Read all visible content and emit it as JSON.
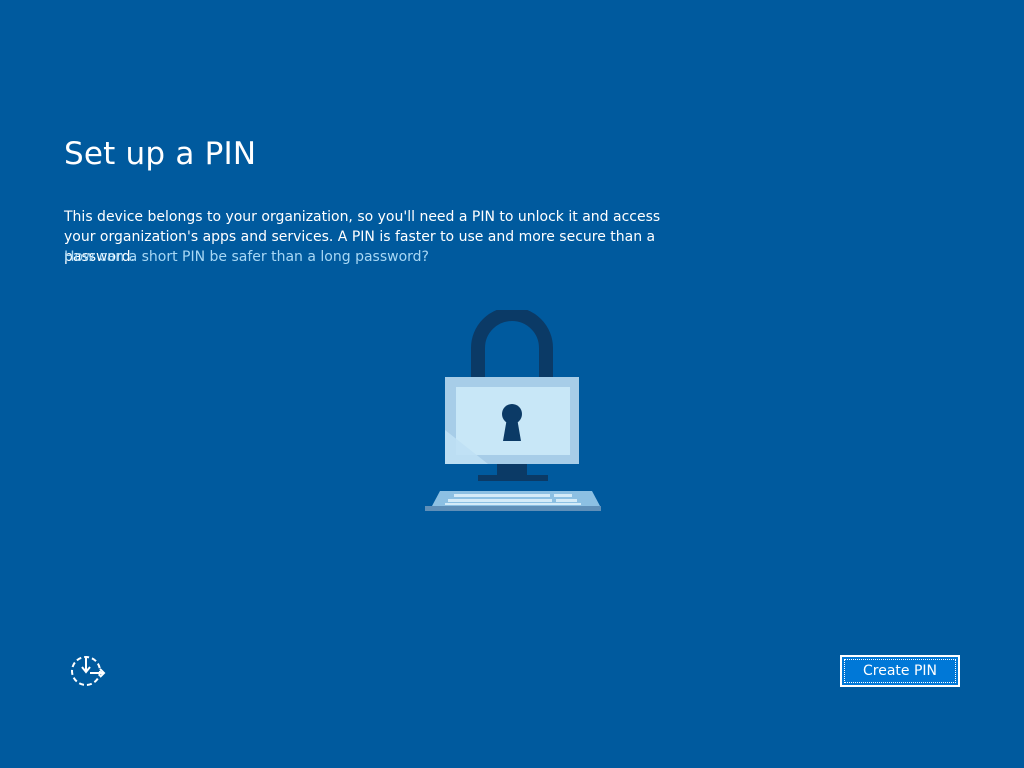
{
  "page": {
    "title": "Set up a PIN",
    "description": "This device belongs to your organization, so you'll need a PIN to unlock it and access your organization's apps and services. A PIN is faster to use and more secure than a password.",
    "help_link": "How can a short PIN be safer than a long password?"
  },
  "illustration": {
    "icon": "computer-padlock-illustration"
  },
  "footer": {
    "ease_of_access_icon": "ease-of-access-icon",
    "create_pin_label": "Create PIN"
  },
  "colors": {
    "background": "#005a9e",
    "link": "#a8d8f5",
    "button": "#0078d7",
    "text": "#ffffff"
  }
}
